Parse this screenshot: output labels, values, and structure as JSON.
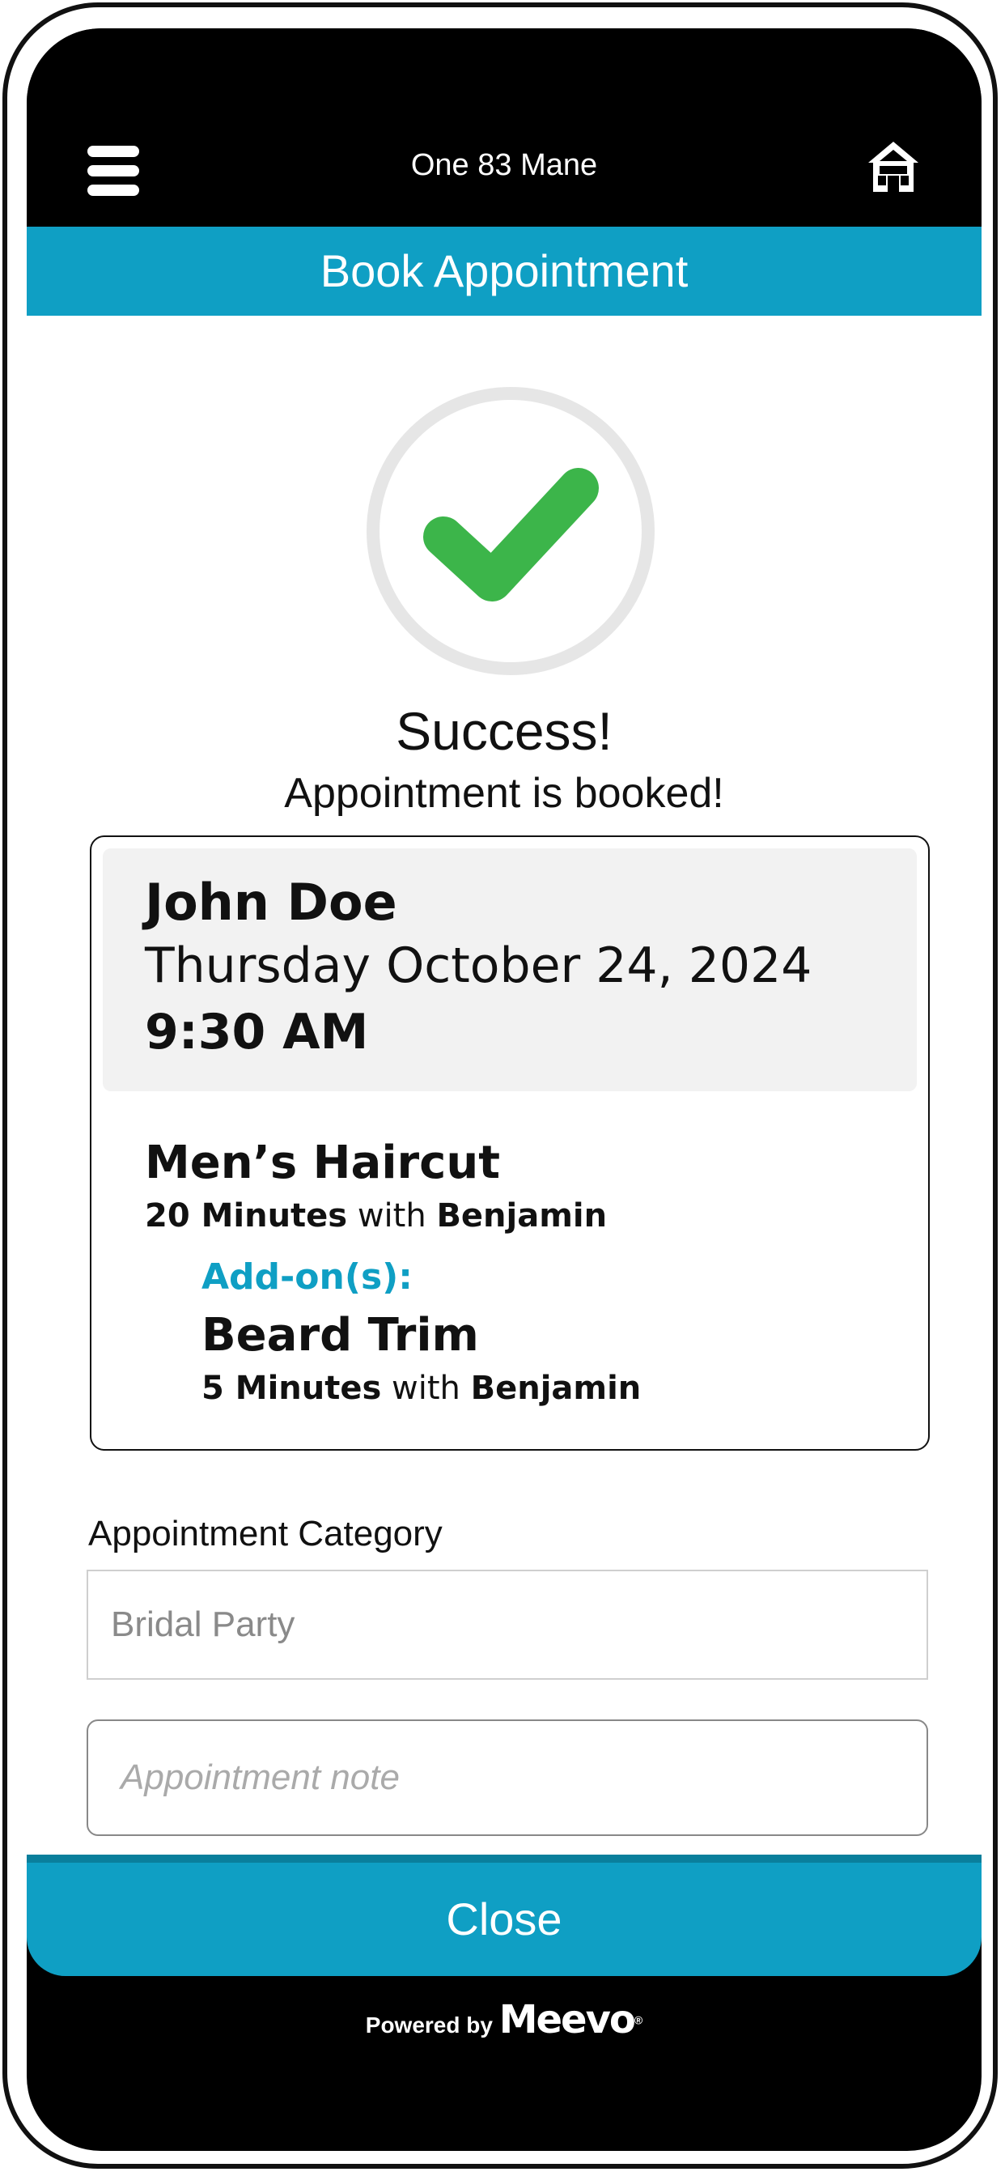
{
  "app": {
    "title": "One 83 Mane"
  },
  "header": {
    "title": "Book Appointment"
  },
  "status": {
    "title": "Success!",
    "subtitle": "Appointment is booked!"
  },
  "appointment": {
    "client_name": "John Doe",
    "date": "Thursday October 24, 2024",
    "time": "9:30 AM",
    "service": {
      "name": "Men’s Haircut",
      "duration": "20 Minutes",
      "with_word": "with",
      "provider": "Benjamin"
    },
    "addons_label": "Add-on(s):",
    "addon": {
      "name": "Beard Trim",
      "duration": "5 Minutes",
      "with_word": "with",
      "provider": "Benjamin"
    }
  },
  "form": {
    "category_label": "Appointment Category",
    "category_value": "Bridal Party",
    "note_placeholder": "Appointment note"
  },
  "footer": {
    "close_label": "Close",
    "powered_by": "Powered by",
    "brand": "Meevo",
    "brand_mark": "®"
  },
  "colors": {
    "accent": "#0f9fc4",
    "success": "#3cb54a",
    "background": "#000000"
  },
  "icons": {
    "menu": "hamburger-icon",
    "home": "home-icon",
    "success": "checkmark-icon"
  }
}
